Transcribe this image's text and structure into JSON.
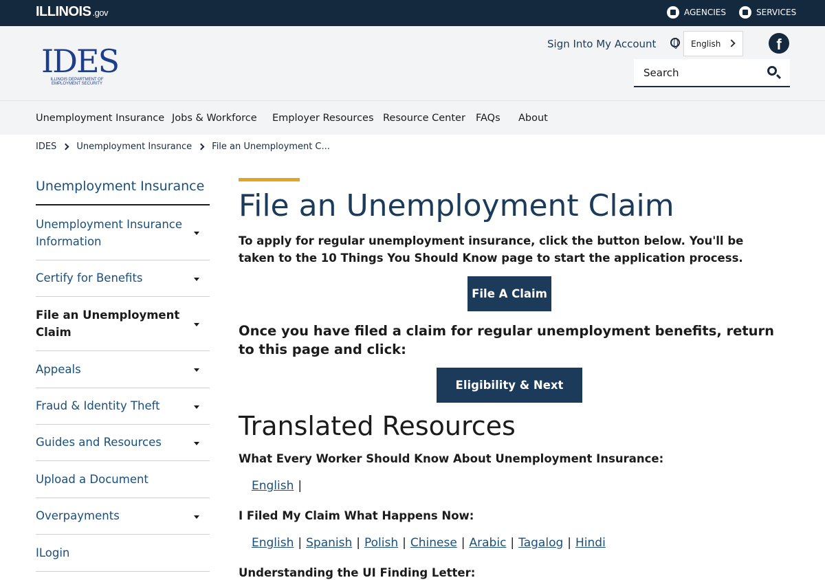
{
  "topbar": {
    "logo_main": "ILLINOIS",
    "logo_suffix": ".gov",
    "agencies": "AGENCIES",
    "services": "SERVICES"
  },
  "header": {
    "logo_text": "IDES",
    "logo_subtext": "ILLINOIS DEPARTMENT OF EMPLOYMENT SECURITY",
    "sign_in": "Sign Into My Account",
    "language": "English",
    "search_placeholder": "Search"
  },
  "nav": {
    "items": [
      "Unemployment Insurance",
      "Jobs & Workforce",
      "Employer Resources",
      "Resource Center",
      "FAQs",
      "About"
    ]
  },
  "breadcrumb": [
    "IDES",
    "Unemployment Insurance",
    "File an Unemployment C..."
  ],
  "sidebar": {
    "title": "Unemployment Insurance",
    "items": [
      {
        "label": "Unemployment Insurance Information"
      },
      {
        "label": "Certify for Benefits"
      },
      {
        "label": "File an Unemployment Claim"
      },
      {
        "label": "Appeals"
      },
      {
        "label": "Fraud & Identity Theft"
      },
      {
        "label": "Guides and Resources"
      },
      {
        "label": "Upload a Document"
      },
      {
        "label": "Overpayments"
      },
      {
        "label": "ILogin"
      }
    ]
  },
  "main": {
    "title": "File an Unemployment Claim",
    "intro": "To apply for regular unemployment insurance, click the button below. You'll be taken to the 10 Things You Should Know page to start the application process.",
    "file_claim_button": "File A Claim",
    "after_text": "Once you have filed a claim for regular unemployment benefits, return to this page and click:",
    "eligibility_button": "Eligibility & Next Steps",
    "translated_heading": "Translated Resources",
    "section1": {
      "heading": "What Every Worker Should Know About Unemployment Insurance:",
      "links": [
        "English"
      ]
    },
    "section2": {
      "heading": "I Filed My Claim What Happens Now:",
      "links": [
        "English",
        "Spanish",
        "Polish",
        "Chinese",
        "Arabic",
        "Tagalog",
        "Hindi"
      ]
    },
    "section3": {
      "heading": "Understanding the UI Finding Letter:"
    }
  },
  "colors": {
    "topbar": "#15293e",
    "brand_navy": "#1c3a59",
    "link_blue": "#1a4f7c",
    "accent_gold": "#e0a622",
    "header_bg": "#f3f4f6"
  },
  "icons": {
    "agencies": "building-icon",
    "services": "gears-icon",
    "language": "globe-icon",
    "social": "facebook-icon",
    "search": "search-icon",
    "nav_caret": "caret-down-icon",
    "breadcrumb_sep": "chevron-right-icon"
  }
}
